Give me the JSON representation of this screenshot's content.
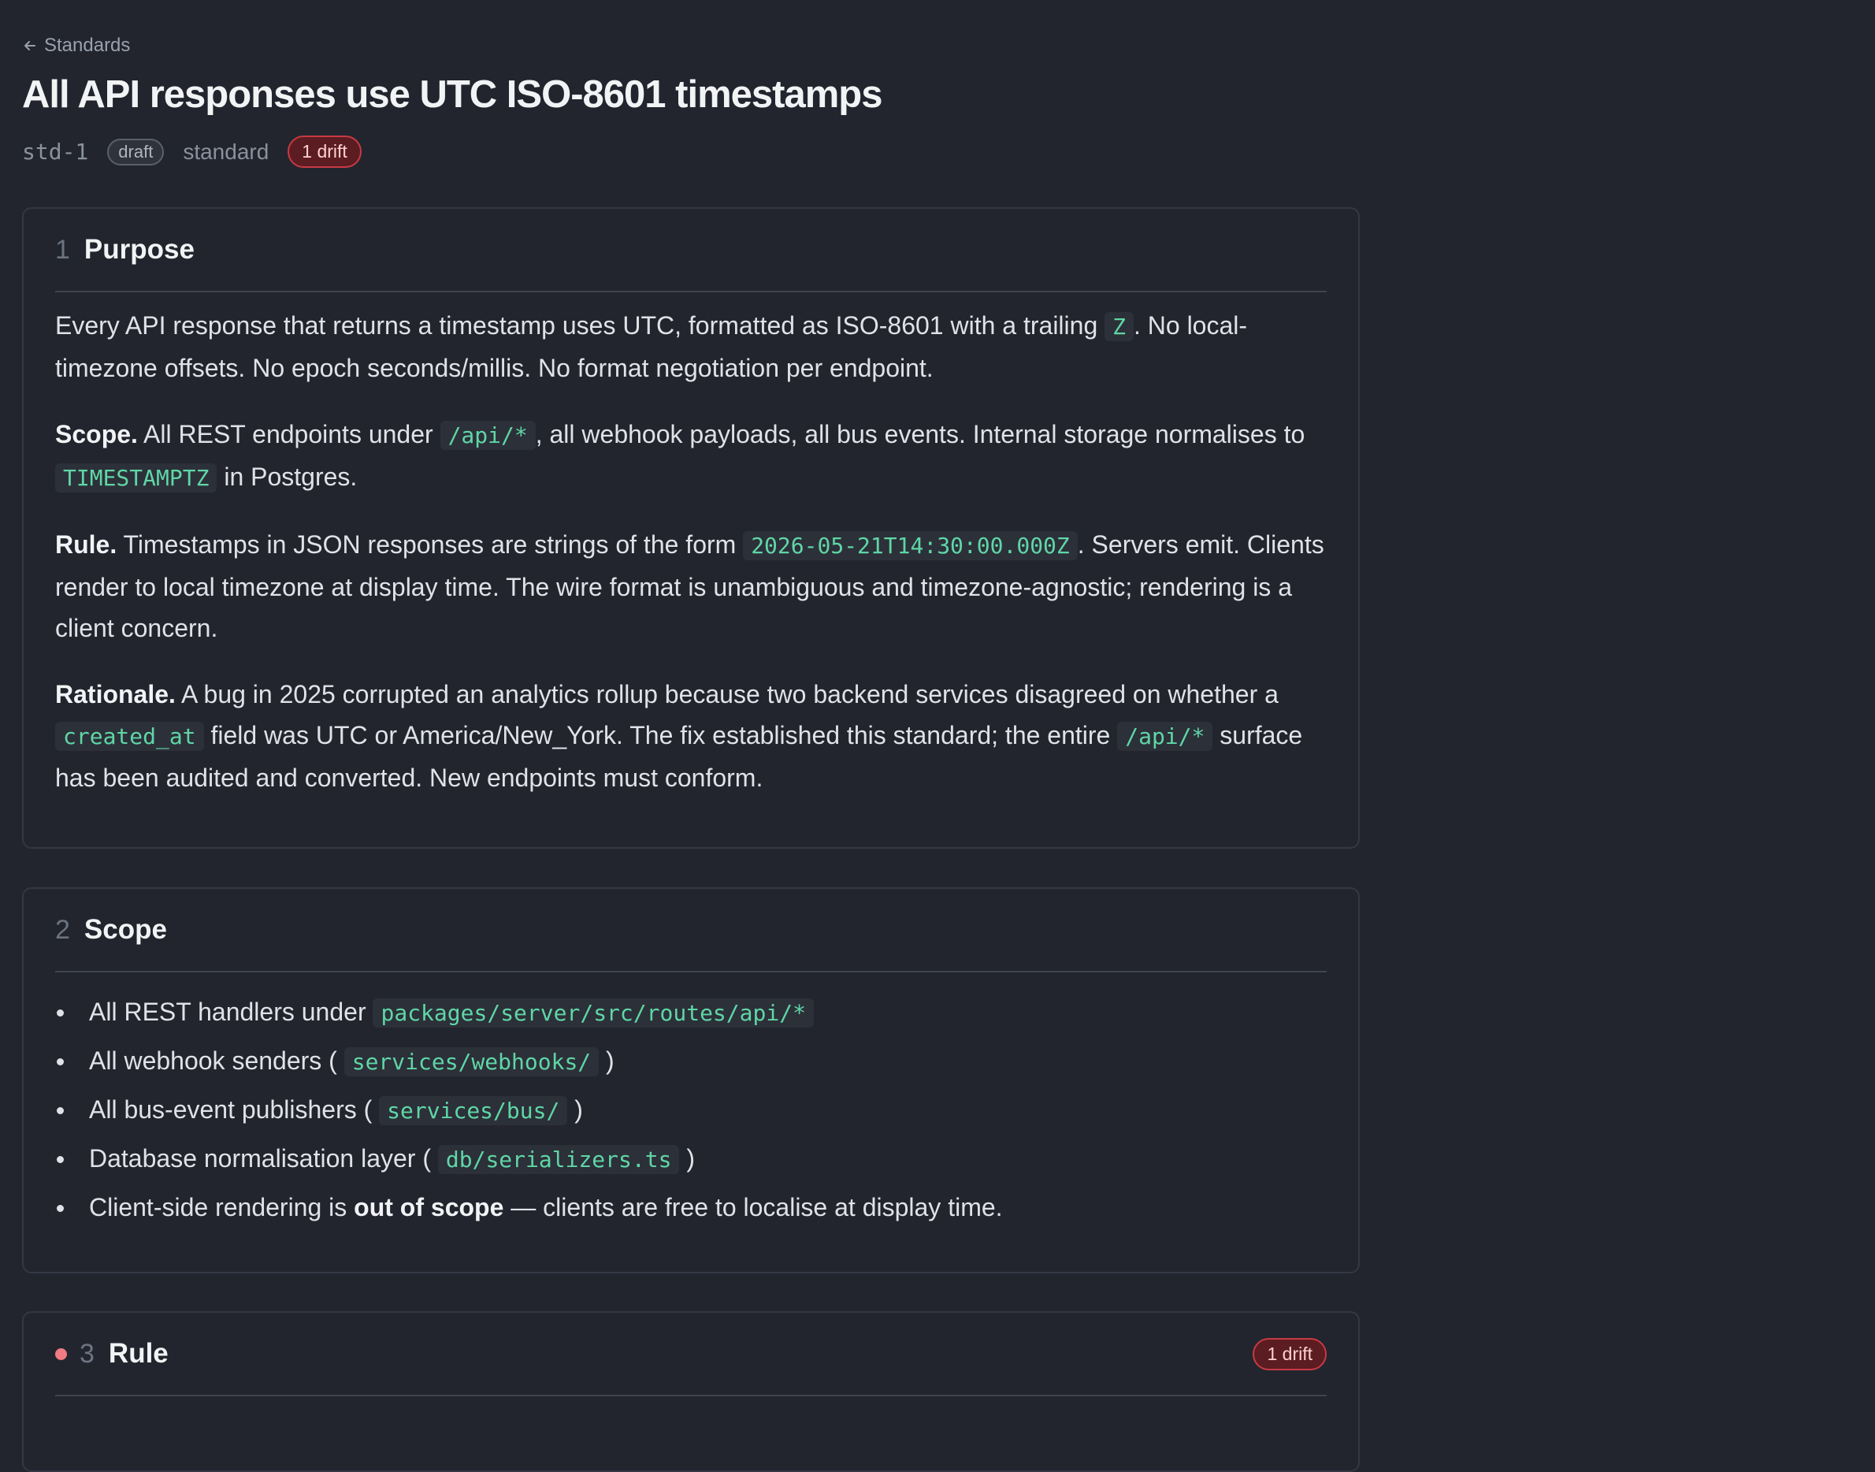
{
  "breadcrumb": {
    "back_label": "Standards",
    "back_icon": "arrow-left-icon"
  },
  "title": "All API responses use UTC ISO-8601 timestamps",
  "meta": {
    "id": "std-1",
    "status": "draft",
    "kind": "standard",
    "drift": "1 drift"
  },
  "colors": {
    "accent_code": "#5fd6a6",
    "drift_bg": "#5b1c22",
    "drift_border": "#c73a44",
    "drift_dot": "#f07b82"
  },
  "sections": {
    "purpose": {
      "number": "1",
      "title": "Purpose",
      "p1": [
        "Every API response that returns a timestamp uses UTC, formatted as ISO-8601 with a trailing ",
        "Z",
        ". No local-timezone offsets. No epoch seconds/millis. No format negotiation per endpoint."
      ],
      "p2": [
        "Scope.",
        " All REST endpoints under ",
        "/api/*",
        ", all webhook payloads, all bus events. Internal storage normalises to ",
        "TIMESTAMPTZ",
        " in Postgres."
      ],
      "p3": [
        "Rule.",
        " Timestamps in JSON responses are strings of the form ",
        "2026-05-21T14:30:00.000Z",
        ". Servers emit. Clients render to local timezone at display time. The wire format is unambiguous and timezone-agnostic; rendering is a client concern."
      ],
      "p4": [
        "Rationale.",
        " A bug in 2025 corrupted an analytics rollup because two backend services disagreed on whether a ",
        "created_at",
        " field was UTC or America/New_York. The fix established this standard; the entire ",
        "/api/*",
        " surface has been audited and converted. New endpoints must conform."
      ]
    },
    "scope": {
      "number": "2",
      "title": "Scope",
      "items": [
        [
          "All REST handlers under ",
          "packages/server/src/routes/api/*",
          ""
        ],
        [
          "All webhook senders (",
          "services/webhooks/",
          ")"
        ],
        [
          "All bus-event publishers (",
          "services/bus/",
          ")"
        ],
        [
          "Database normalisation layer (",
          "db/serializers.ts",
          ")"
        ]
      ],
      "last_item": [
        "Client-side rendering is ",
        "out of scope",
        " — clients are free to localise at display time."
      ]
    },
    "rule": {
      "number": "3",
      "title": "Rule",
      "drift": "1 drift"
    }
  }
}
